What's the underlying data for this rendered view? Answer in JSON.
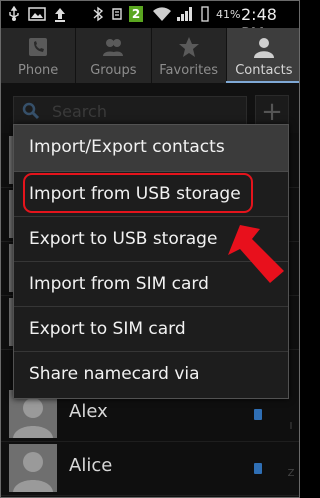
{
  "status_bar": {
    "battery_percent": "41%",
    "time": "2:48 PM",
    "icons": [
      "usb-icon",
      "gallery-icon",
      "upload-icon",
      "bluetooth-icon",
      "sync-icon",
      "notification-2-icon",
      "wifi-icon",
      "signal-icon",
      "battery-icon"
    ],
    "notification_count": "2"
  },
  "tabs": [
    {
      "label": "Phone",
      "icon": "phone-icon"
    },
    {
      "label": "Groups",
      "icon": "groups-icon"
    },
    {
      "label": "Favorites",
      "icon": "star-icon"
    },
    {
      "label": "Contacts",
      "icon": "person-icon",
      "selected": true
    }
  ],
  "search": {
    "placeholder": "Search",
    "add_label": "+"
  },
  "contacts": [
    {
      "name": "Alex"
    },
    {
      "name": "Alice"
    }
  ],
  "index_letters": [
    "I",
    "Z"
  ],
  "dialog": {
    "title": "Import/Export contacts",
    "items": [
      "Import from USB storage",
      "Export to USB storage",
      "Import from SIM card",
      "Export to SIM card",
      "Share namecard via"
    ],
    "highlighted_item": "Import from USB storage"
  },
  "colors": {
    "highlight": "#e4141c",
    "arrow": "#e8101c",
    "tab_indicator": "#7fa9d6"
  }
}
